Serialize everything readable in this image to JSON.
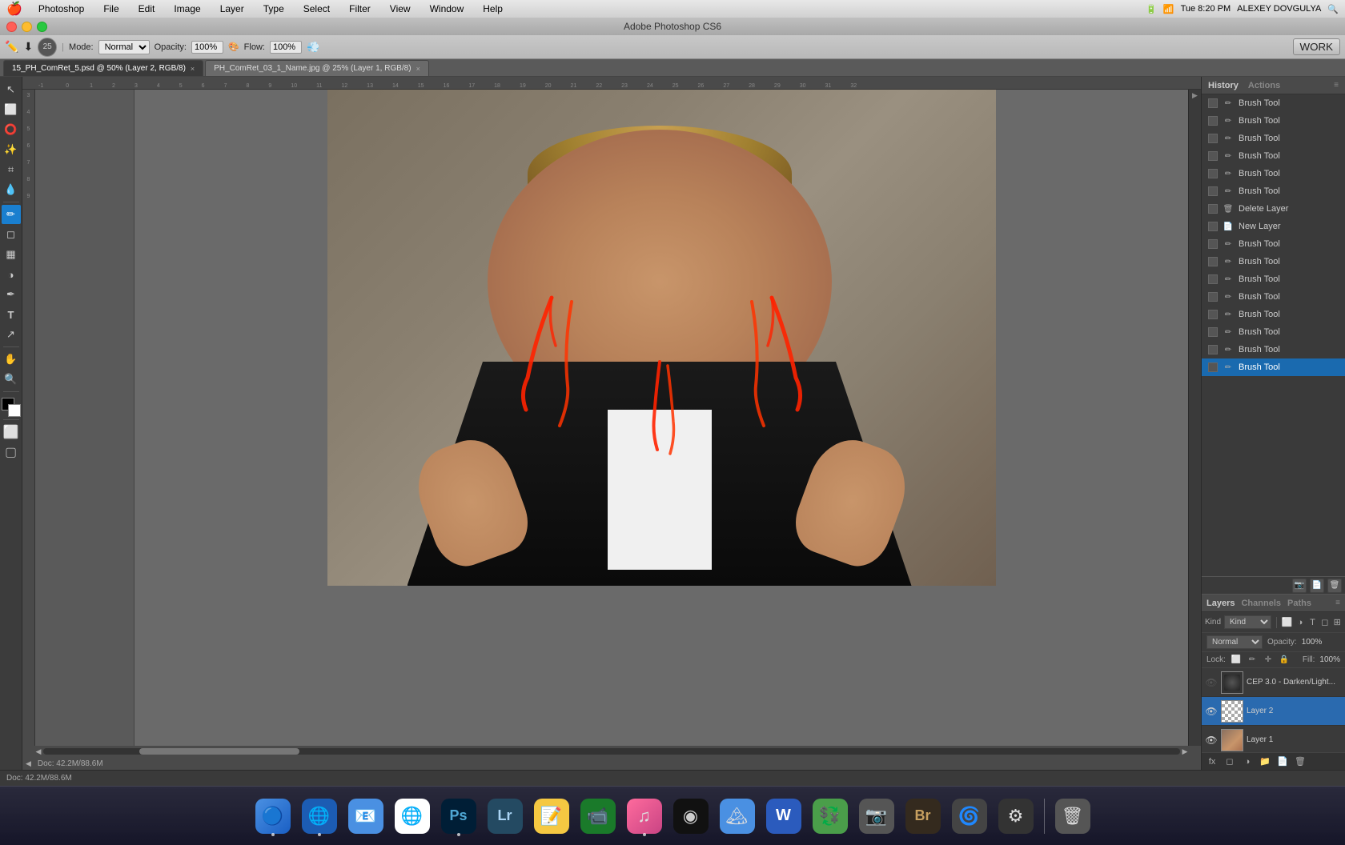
{
  "app": {
    "title": "Adobe Photoshop CS6",
    "version": "CS6"
  },
  "menubar": {
    "apple": "🍎",
    "items": [
      "Photoshop",
      "File",
      "Edit",
      "Image",
      "Layer",
      "Type",
      "Select",
      "Filter",
      "View",
      "Window",
      "Help"
    ],
    "right": {
      "battery": "100%",
      "time": "Tue 8:20 PM",
      "user": "ALEXEY DOVGULYA"
    }
  },
  "window_controls": {
    "close": "×",
    "min": "−",
    "max": "+"
  },
  "options_bar": {
    "tool_icon": "✏",
    "mode_label": "Mode:",
    "mode_value": "Normal",
    "opacity_label": "Opacity:",
    "opacity_value": "100%",
    "flow_label": "Flow:",
    "flow_value": "100%",
    "work_label": "WORK"
  },
  "tabs": [
    {
      "id": "tab1",
      "label": "15_PH_ComRet_5.psd @ 50% (Layer 2, RGB/8)",
      "active": true,
      "modified": true
    },
    {
      "id": "tab2",
      "label": "PH_ComRet_03_1_Name.jpg @ 25% (Layer 1, RGB/8)",
      "active": false,
      "modified": false
    }
  ],
  "tools": [
    {
      "id": "move",
      "icon": "↖",
      "active": false
    },
    {
      "id": "marquee",
      "icon": "⬜",
      "active": false
    },
    {
      "id": "lasso",
      "icon": "⭕",
      "active": false
    },
    {
      "id": "magic-wand",
      "icon": "✨",
      "active": false
    },
    {
      "id": "crop",
      "icon": "⌗",
      "active": false
    },
    {
      "id": "eyedropper",
      "icon": "💧",
      "active": false
    },
    {
      "id": "brush",
      "icon": "✏",
      "active": true
    },
    {
      "id": "eraser",
      "icon": "◻",
      "active": false
    },
    {
      "id": "gradient",
      "icon": "▦",
      "active": false
    },
    {
      "id": "dodge",
      "icon": "◑",
      "active": false
    },
    {
      "id": "pen",
      "icon": "✒",
      "active": false
    },
    {
      "id": "type",
      "icon": "T",
      "active": false
    },
    {
      "id": "path-select",
      "icon": "↗",
      "active": false
    },
    {
      "id": "hand",
      "icon": "✋",
      "active": false
    },
    {
      "id": "zoom",
      "icon": "🔍",
      "active": false
    }
  ],
  "history": {
    "panel_title": "History",
    "actions_title": "Actions",
    "items": [
      {
        "id": 1,
        "label": "Brush Tool",
        "icon": "brush",
        "active": false
      },
      {
        "id": 2,
        "label": "Brush Tool",
        "icon": "brush",
        "active": false
      },
      {
        "id": 3,
        "label": "Brush Tool",
        "icon": "brush",
        "active": false
      },
      {
        "id": 4,
        "label": "Brush Tool",
        "icon": "brush",
        "active": false
      },
      {
        "id": 5,
        "label": "Brush Tool",
        "icon": "brush",
        "active": false
      },
      {
        "id": 6,
        "label": "Brush Tool",
        "icon": "brush",
        "active": false
      },
      {
        "id": 7,
        "label": "Delete Layer",
        "icon": "layer",
        "active": false
      },
      {
        "id": 8,
        "label": "New Layer",
        "icon": "new-layer",
        "active": false
      },
      {
        "id": 9,
        "label": "Brush Tool",
        "icon": "brush",
        "active": false
      },
      {
        "id": 10,
        "label": "Brush Tool",
        "icon": "brush",
        "active": false
      },
      {
        "id": 11,
        "label": "Brush Tool",
        "icon": "brush",
        "active": false
      },
      {
        "id": 12,
        "label": "Brush Tool",
        "icon": "brush",
        "active": false
      },
      {
        "id": 13,
        "label": "Brush Tool",
        "icon": "brush",
        "active": false
      },
      {
        "id": 14,
        "label": "Brush Tool",
        "icon": "brush",
        "active": false
      },
      {
        "id": 15,
        "label": "Brush Tool",
        "icon": "brush",
        "active": false
      },
      {
        "id": 16,
        "label": "Brush Tool",
        "icon": "brush",
        "active": true
      }
    ]
  },
  "layers": {
    "panel_title": "Layers",
    "channels_title": "Channels",
    "paths_title": "Paths",
    "filter_kind": "Kind",
    "blend_mode": "Normal",
    "opacity_label": "Opacity:",
    "opacity_value": "100%",
    "fill_label": "Fill:",
    "fill_value": "100%",
    "lock_label": "Lock:",
    "items": [
      {
        "id": "cep",
        "name": "CEP 3.0 - Darken/Light...",
        "visible": false,
        "type": "adjustment",
        "active": false
      },
      {
        "id": "layer2",
        "name": "Layer 2",
        "visible": true,
        "type": "normal",
        "active": true
      },
      {
        "id": "layer1",
        "name": "Layer 1",
        "visible": true,
        "type": "photo",
        "active": false
      }
    ]
  },
  "ruler": {
    "unit": "in",
    "ticks": [
      "-1",
      "0",
      "1",
      "2",
      "3",
      "4",
      "5",
      "6",
      "7",
      "8",
      "9",
      "10",
      "11",
      "12",
      "13",
      "14",
      "15",
      "16",
      "17",
      "18",
      "19",
      "20",
      "21",
      "22",
      "23",
      "24",
      "25",
      "26",
      "27",
      "28",
      "29",
      "30",
      "31",
      "32"
    ]
  },
  "status_bar": {
    "doc_size": "Doc: 42.2M/88.6M",
    "zoom": "50%"
  },
  "dock": {
    "items": [
      {
        "id": "finder",
        "icon": "🔵",
        "color": "#1e78c4",
        "label": "Finder"
      },
      {
        "id": "safari",
        "icon": "🔵",
        "color": "#0076d6",
        "label": "Safari"
      },
      {
        "id": "mail",
        "icon": "📧",
        "color": "#4a90e2",
        "label": "Mail"
      },
      {
        "id": "chrome",
        "icon": "🌐",
        "color": "#ea4335",
        "label": "Chrome"
      },
      {
        "id": "photoshop",
        "icon": "Ps",
        "color": "#001e36",
        "label": "Photoshop"
      },
      {
        "id": "lightroom",
        "icon": "Lr",
        "color": "#244a62",
        "label": "Lightroom"
      },
      {
        "id": "stickies",
        "icon": "📝",
        "color": "#f5c842",
        "label": "Stickies"
      },
      {
        "id": "facetime",
        "icon": "📹",
        "color": "#4caf50",
        "label": "FaceTime"
      },
      {
        "id": "itunes",
        "icon": "♫",
        "color": "#ea4c6c",
        "label": "iTunes"
      },
      {
        "id": "aperture",
        "icon": "◉",
        "color": "#1a1a1a",
        "label": "Aperture"
      },
      {
        "id": "iphoto",
        "icon": "🏔",
        "color": "#4a90e2",
        "label": "iPhoto"
      },
      {
        "id": "word",
        "icon": "W",
        "color": "#2b5bbd",
        "label": "Word"
      },
      {
        "id": "currency",
        "icon": "💱",
        "color": "#4a9e4a",
        "label": "Currency"
      },
      {
        "id": "app8",
        "icon": "📷",
        "color": "#555",
        "label": "App"
      },
      {
        "id": "bridge",
        "icon": "Br",
        "color": "#342a1e",
        "label": "Bridge"
      },
      {
        "id": "app9",
        "icon": "🌀",
        "color": "#444",
        "label": "App"
      },
      {
        "id": "app10",
        "icon": "⚙",
        "color": "#333",
        "label": "App"
      },
      {
        "id": "trash",
        "icon": "🗑",
        "color": "#555",
        "label": "Trash"
      }
    ]
  }
}
